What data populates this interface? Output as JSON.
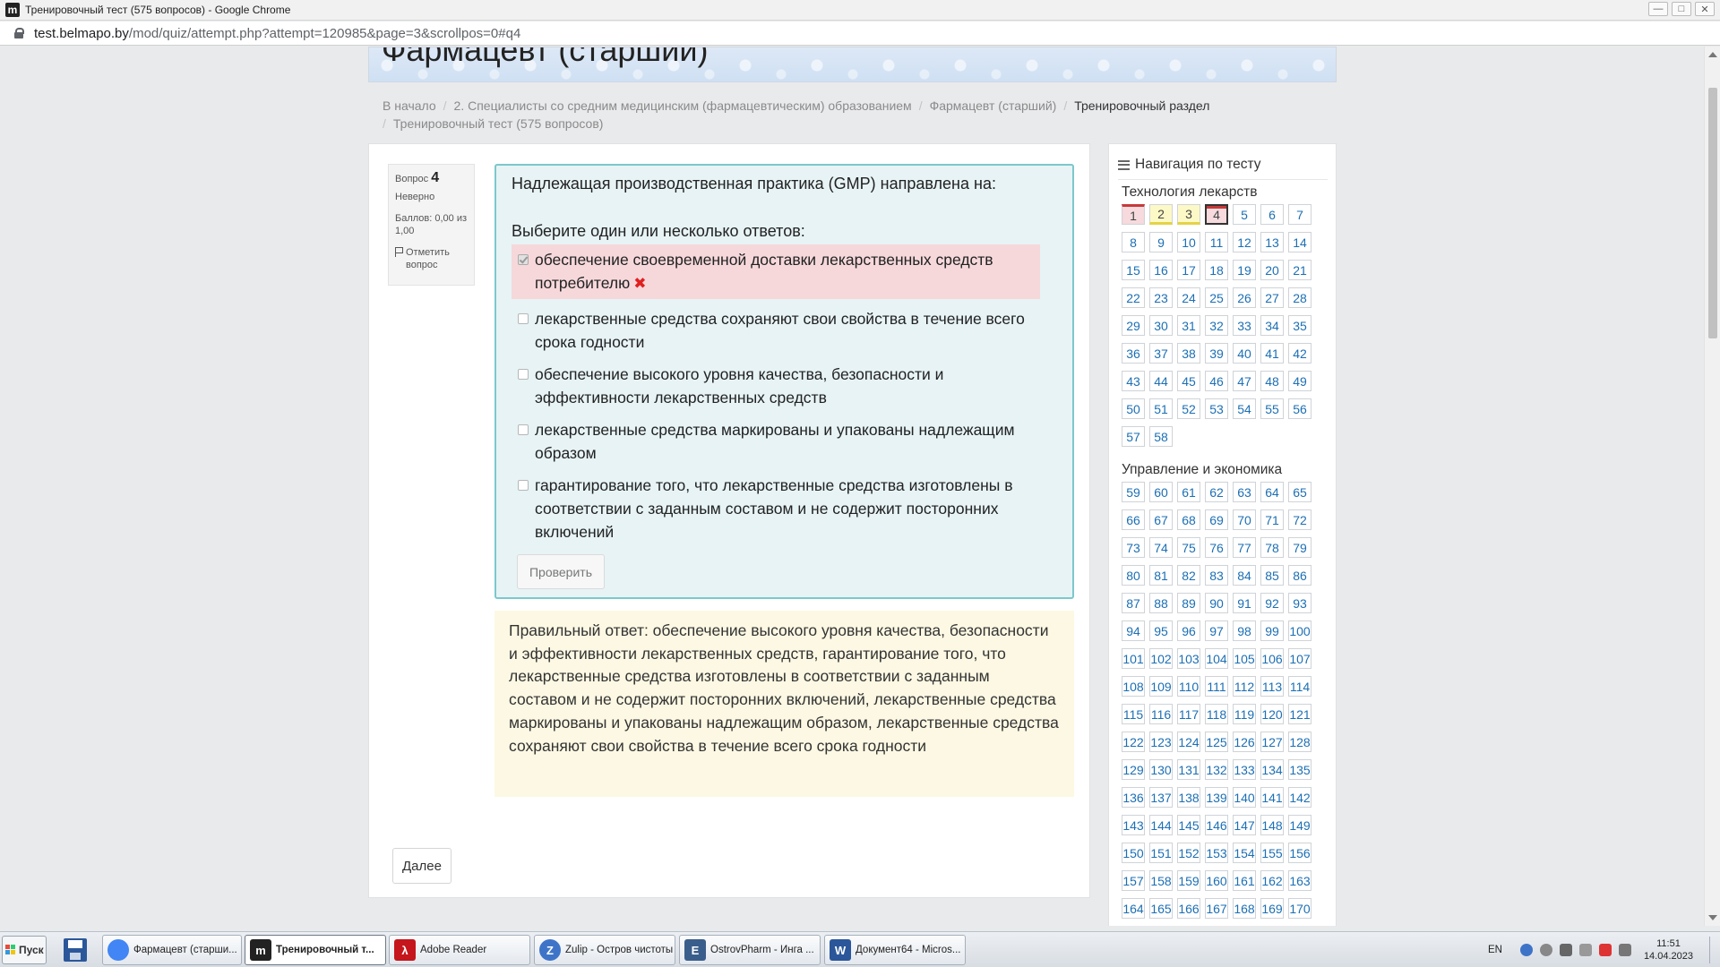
{
  "window": {
    "title": "Тренировочный тест (575 вопросов) - Google Chrome",
    "app_icon": "m"
  },
  "address_bar": {
    "host": "test.belmapo.by",
    "path": "/mod/quiz/attempt.php?attempt=120985&page=3&scrollpos=0#q4"
  },
  "header": {
    "course_title": "Фармацевт (старший)"
  },
  "breadcrumb": {
    "items": [
      "В начало",
      "2. Специалисты со средним медицинским (фармацевтическим) образованием",
      "Фармацевт (старший)"
    ],
    "current_1": "Тренировочный раздел",
    "current_2": "Тренировочный тест (575 вопросов)"
  },
  "question_info": {
    "label": "Вопрос",
    "number": "4",
    "state": "Неверно",
    "grade": "Баллов: 0,00 из 1,00",
    "flag_label": "Отметить вопрос"
  },
  "question": {
    "text": "Надлежащая производственная практика (GMP) направлена на:",
    "prompt": "Выберите один или несколько ответов:",
    "answers": [
      {
        "text": "обеспечение своевременной доставки лекарственных средств потребителю",
        "checked": true,
        "status": "incorrect"
      },
      {
        "text": "лекарственные средства сохраняют свои свойства в течение всего срока годности",
        "checked": false
      },
      {
        "text": "обеспечение высокого уровня качества, безопасности и эффективности лекарственных средств",
        "checked": false
      },
      {
        "text": "лекарственные средства маркированы и упакованы надлежащим образом",
        "checked": false
      },
      {
        "text": "гарантирование того, что лекарственные средства изготовлены в соответствии с заданным составом и не содержит посторонних включений",
        "checked": false
      }
    ],
    "check_button": "Проверить"
  },
  "feedback": {
    "right_answer": "Правильный ответ: обеспечение высокого уровня качества, безопасности и эффективности лекарственных средств, гарантирование того, что лекарственные средства изготовлены в соответствии с заданным составом и не содержит посторонних включений, лекарственные средства маркированы и упакованы надлежащим образом, лекарственные средства сохраняют свои свойства в течение всего срока годности"
  },
  "next_button": "Далее",
  "navigation": {
    "title": "Навигация по тесту",
    "sections": [
      {
        "title": "Технология лекарств",
        "first": 1,
        "last": 58
      },
      {
        "title": "Управление и экономика",
        "first": 59,
        "last": 170
      }
    ],
    "question_states": {
      "1": "wrong",
      "2": "partial",
      "3": "partial",
      "4": "current"
    }
  },
  "taskbar": {
    "start": "Пуск",
    "items": [
      {
        "label": "Фармацевт (старши...",
        "icon": "chrome-icon"
      },
      {
        "label": "Тренировочный т...",
        "icon": "moodle-icon",
        "active": true
      },
      {
        "label": "Adobe Reader",
        "icon": "adobe-reader-icon"
      },
      {
        "label": "Zulip - Остров чистоты",
        "icon": "zulip-icon"
      },
      {
        "label": "OstrovPharm - Инга ...",
        "icon": "ostrovpharm-icon"
      },
      {
        "label": "Документ64 - Micros...",
        "icon": "word-icon"
      }
    ],
    "lang": "EN",
    "time": "11:51",
    "date": "14.04.2023",
    "colors": {
      "chrome": "#4285f4",
      "moodle": "#222222",
      "adobe": "#c4161c",
      "zulip": "#3e74c8",
      "word": "#2b579a"
    }
  }
}
